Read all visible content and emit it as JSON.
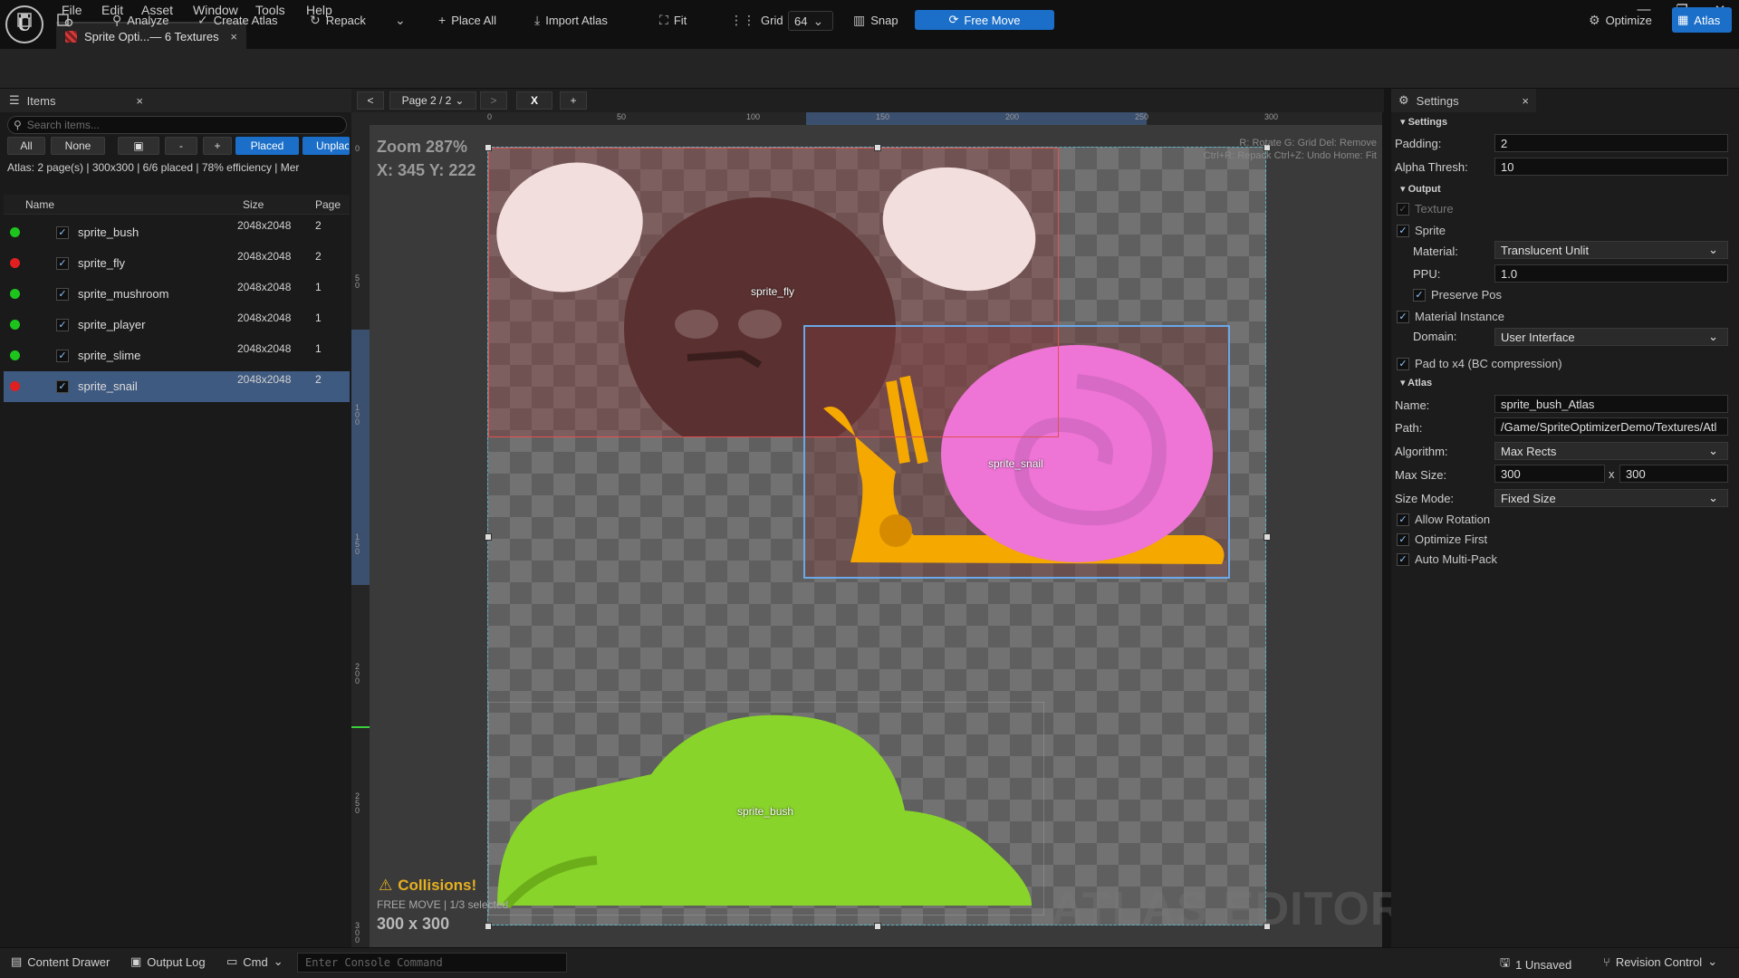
{
  "menu": [
    "File",
    "Edit",
    "Asset",
    "Window",
    "Tools",
    "Help"
  ],
  "doc_tab": {
    "title": "Sprite Opti...— 6 Textures",
    "close": "×"
  },
  "window_controls": [
    "—",
    "❐",
    "✕"
  ],
  "toolbar": {
    "analyze": "Analyze",
    "create_atlas": "Create Atlas",
    "repack": "Repack",
    "place_all": "Place All",
    "import_atlas": "Import Atlas",
    "fit": "Fit",
    "grid": "Grid",
    "grid_size": "64",
    "snap": "Snap",
    "free_move": "Free Move",
    "optimize": "Optimize",
    "atlas": "Atlas"
  },
  "items_panel": {
    "title": "Items",
    "close": "×",
    "search_placeholder": "Search items...",
    "filters": {
      "all": "All",
      "none": "None",
      "minus": "-",
      "plus": "+",
      "placed": "Placed",
      "unplaced": "Unplac"
    },
    "atlas_info": "Atlas: 2 page(s)  |  300x300  |  6/6 placed  |  78% efficiency  |  Mer",
    "columns": {
      "name": "Name",
      "size": "Size",
      "page": "Page"
    },
    "rows": [
      {
        "name": "sprite_bush",
        "size": "2048x2048",
        "page": "2",
        "status": "#1ec41e",
        "selected": false
      },
      {
        "name": "sprite_fly",
        "size": "2048x2048",
        "page": "2",
        "status": "#e02020",
        "selected": false
      },
      {
        "name": "sprite_mushroom",
        "size": "2048x2048",
        "page": "1",
        "status": "#1ec41e",
        "selected": false
      },
      {
        "name": "sprite_player",
        "size": "2048x2048",
        "page": "1",
        "status": "#1ec41e",
        "selected": false
      },
      {
        "name": "sprite_slime",
        "size": "2048x2048",
        "page": "1",
        "status": "#1ec41e",
        "selected": false
      },
      {
        "name": "sprite_snail",
        "size": "2048x2048",
        "page": "2",
        "status": "#e02020",
        "selected": true
      }
    ]
  },
  "canvas": {
    "prev": "<",
    "page_select": "Page 2 / 2",
    "next": ">",
    "remove": "X",
    "add": "+",
    "zoom": "Zoom  287%",
    "coords": "X: 345   Y: 222",
    "hint1": "R: Rotate   G: Grid   Del: Remove",
    "hint2": "Ctrl+R: Repack   Ctrl+Z: Undo   Home: Fit",
    "ruler_x": [
      "0",
      "50",
      "100",
      "150",
      "200",
      "250",
      "300"
    ],
    "ruler_y": [
      "0",
      "5 0",
      "1 0 0",
      "1 5 0",
      "2 0 0",
      "2 5 0",
      "3 0 0"
    ],
    "sprites": {
      "fly": "sprite_fly",
      "snail": "sprite_snail",
      "bush": "sprite_bush"
    },
    "collision": "Collisions!",
    "mode": "FREE MOVE | 1/3 selected",
    "size": "300 x 300",
    "watermark": "ATLAS EDITOR"
  },
  "settings": {
    "title": "Settings",
    "close": "×",
    "section": "Settings",
    "padding_label": "Padding:",
    "padding": "2",
    "alpha_label": "Alpha Thresh:",
    "alpha": "10",
    "output_section": "Output",
    "texture": "Texture",
    "sprite": "Sprite",
    "material_label": "Material:",
    "material": "Translucent Unlit",
    "ppu_label": "PPU:",
    "ppu": "1.0",
    "preserve_pos": "Preserve Pos",
    "material_instance": "Material Instance",
    "domain_label": "Domain:",
    "domain": "User Interface",
    "pad_x4": "Pad to x4 (BC compression)",
    "atlas_section": "Atlas",
    "name_label": "Name:",
    "name": "sprite_bush_Atlas",
    "path_label": "Path:",
    "path": "/Game/SpriteOptimizerDemo/Textures/Atl",
    "algorithm_label": "Algorithm:",
    "algorithm": "Max Rects",
    "max_size_label": "Max Size:",
    "max_w": "300",
    "max_x": "x",
    "max_h": "300",
    "size_mode_label": "Size Mode:",
    "size_mode": "Fixed Size",
    "allow_rotation": "Allow Rotation",
    "optimize_first": "Optimize First",
    "auto_multi_pack": "Auto Multi-Pack"
  },
  "statusbar": {
    "content_drawer": "Content Drawer",
    "output_log": "Output Log",
    "cmd": "Cmd",
    "console_placeholder": "Enter Console Command",
    "unsaved": "1 Unsaved",
    "revision": "Revision Control"
  },
  "colors": {
    "accent": "#1b6fc9",
    "selected_row": "#3f5a80",
    "fly_box": "#e05050",
    "snail_box": "#6aa8e8",
    "collision": "#e6b020"
  }
}
